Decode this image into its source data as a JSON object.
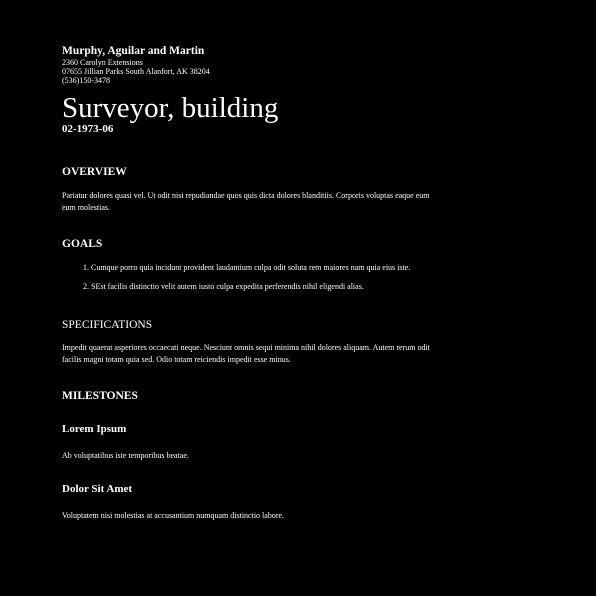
{
  "company": {
    "name": "Murphy, Aguilar and Martin",
    "address_line1": "2360 Carolyn Extensions",
    "address_line2": "07655 Jillian Parks South Alanfort, AK 38204",
    "phone": "(536)150-3478"
  },
  "document": {
    "title": "Surveyor, building",
    "code": "02-1973-06"
  },
  "overview": {
    "heading": "OVERVIEW",
    "text": "Pariatur dolores quasi vel. Ut odit nisi repudiandae quos quis dicta dolores blanditiis. Corporis voluptas eaque eum eum molestias."
  },
  "goals": {
    "heading": "GOALS",
    "items": [
      "Cumque porro quia incidunt provident laudantium culpa odit soluta rem maiores nam quia eius iste.",
      "SEst facilis distinctio velit autem iusto culpa expedita perferendis nihil eligendi alias."
    ]
  },
  "specifications": {
    "heading": "SPECIFICATIONS",
    "text": "Impedit quaerat asperiores occaecati neque. Nesciunt omnis sequi minima nihil dolores aliquam. Autem rerum odit facilis magni totam quia sed. Odio totam reiciendis impedit esse minus."
  },
  "milestones": {
    "heading": "MILESTONES",
    "items": [
      {
        "title": "Lorem Ipsum",
        "text": "Ab voluptatibus iste temporibus beatae."
      },
      {
        "title": "Dolor Sit Amet",
        "text": "Voluptatem nisi molestias at accusantium numquam distinctio labore."
      }
    ]
  },
  "colors": {
    "background": "#000000",
    "text": "#ffffff"
  }
}
